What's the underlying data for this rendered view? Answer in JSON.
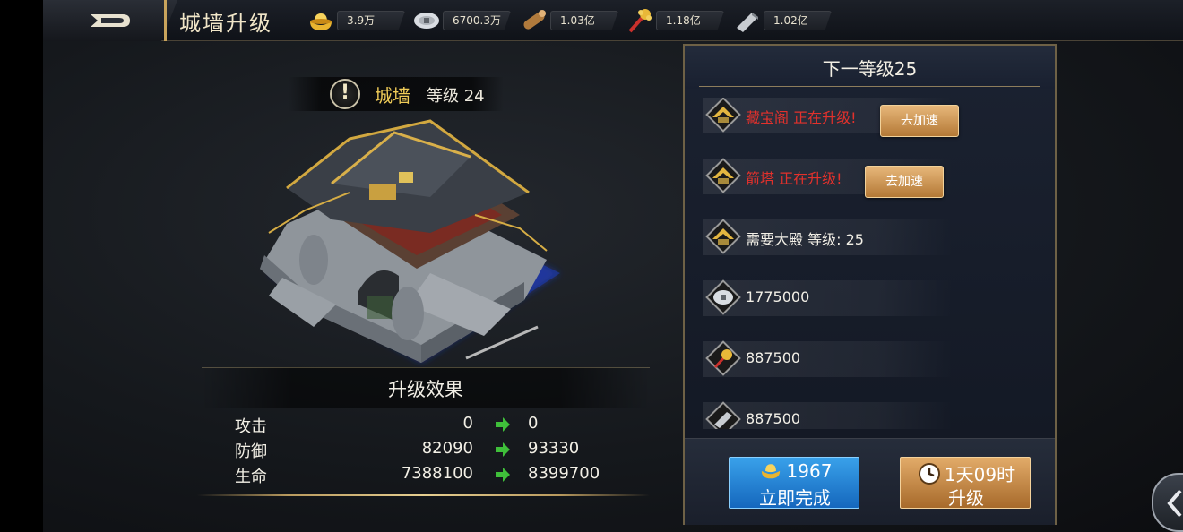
{
  "header": {
    "title": "城墙升级",
    "resources": [
      {
        "icon": "gold-ingot-icon",
        "value": "3.9万"
      },
      {
        "icon": "silver-coin-icon",
        "value": "6700.3万"
      },
      {
        "icon": "wood-log-icon",
        "value": "1.03亿"
      },
      {
        "icon": "grain-bundle-icon",
        "value": "1.18亿"
      },
      {
        "icon": "iron-bar-icon",
        "value": "1.02亿"
      }
    ]
  },
  "building": {
    "name": "城墙",
    "level_label": "等级 24"
  },
  "effects": {
    "title": "升级效果",
    "rows": [
      {
        "label": "攻击",
        "current": "0",
        "next": "0"
      },
      {
        "label": "防御",
        "current": "82090",
        "next": "93330"
      },
      {
        "label": "生命",
        "current": "7388100",
        "next": "8399700"
      }
    ]
  },
  "panel": {
    "title": "下一等级25",
    "requirements": [
      {
        "icon": "building-roof-icon",
        "text": "藏宝阁 正在升级!",
        "color": "#e3312c",
        "button": "去加速"
      },
      {
        "icon": "building-roof-icon",
        "text": "箭塔 正在升级!",
        "color": "#e3312c",
        "button": "去加速"
      },
      {
        "icon": "building-roof-icon",
        "text": "需要大殿 等级: 25",
        "color": "#f2efe6"
      },
      {
        "icon": "silver-coin-icon",
        "text": "1775000",
        "color": "#f2efe6"
      },
      {
        "icon": "grain-bundle-icon",
        "text": "887500",
        "color": "#f2efe6"
      },
      {
        "icon": "iron-bar-icon",
        "text": "887500",
        "color": "#f2efe6"
      }
    ],
    "instant_button": {
      "cost": "1967",
      "label": "立即完成"
    },
    "upgrade_button": {
      "time": "1天09时",
      "label": "升级"
    }
  },
  "colors": {
    "accent_gold": "#c9a45c",
    "warning_red": "#e3312c",
    "instant_blue": "#1f7fd1",
    "upgrade_orange": "#c98a43"
  }
}
